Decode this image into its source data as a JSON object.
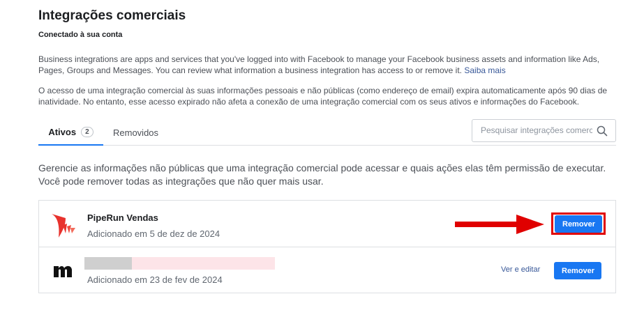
{
  "header": {
    "title": "Integrações comerciais",
    "subtitle": "Conectado à sua conta"
  },
  "intro": {
    "paragraph1": "Business integrations are apps and services that you've logged into with Facebook to manage your Facebook business assets and information like Ads, Pages, Groups and Messages. You can review what information a business integration has access to or remove it.",
    "learn_more": "Saiba mais",
    "paragraph2": "O acesso de uma integração comercial às suas informações pessoais e não públicas (como endereço de email) expira automaticamente após 90 dias de inatividade. No entanto, esse acesso expirado não afeta a conexão de uma integração comercial com os seus ativos e informações do Facebook."
  },
  "tabs": {
    "active_label": "Ativos",
    "active_count": "2",
    "removed_label": "Removidos"
  },
  "search": {
    "placeholder": "Pesquisar integrações comerciais",
    "icon": "search-icon"
  },
  "main": {
    "manage_text": "Gerencie as informações não públicas que uma integração comercial pode acessar e quais ações elas têm permissão de executar. Você pode remover todas as integrações que não quer mais usar."
  },
  "integrations": [
    {
      "name": "PipeRun Vendas",
      "added": "Adicionado em 5 de dez de 2024",
      "remove_label": "Remover",
      "logo": "piperun-logo-icon"
    },
    {
      "name": "",
      "added": "Adicionado em 23 de fev de 2024",
      "view_edit_label": "Ver e editar",
      "remove_label": "Remover",
      "logo": "m-logo-icon"
    }
  ],
  "colors": {
    "primary": "#1877f2",
    "link": "#385898",
    "annotation": "#e00000"
  }
}
